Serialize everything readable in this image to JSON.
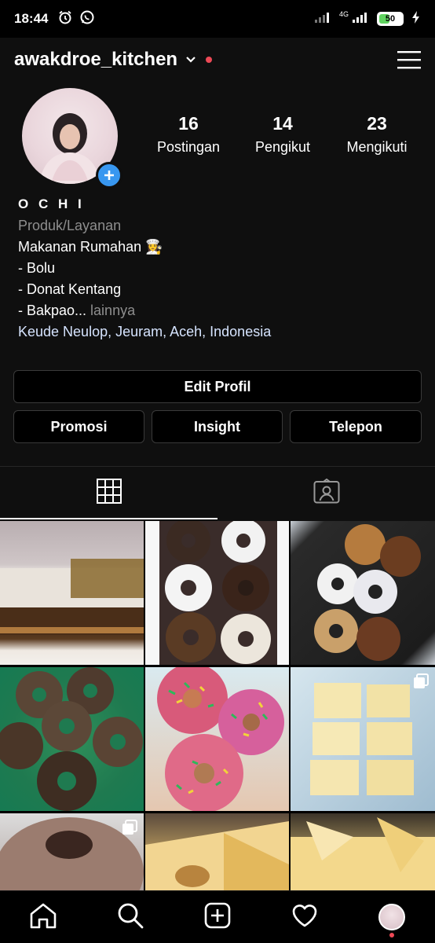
{
  "status_bar": {
    "time": "18:44",
    "network_label": "4G",
    "battery": "50",
    "battery_level": 0.5
  },
  "header": {
    "username": "awakdroe_kitchen",
    "notification_dot_color": "#ed4956"
  },
  "profile": {
    "stats": [
      {
        "value": "16",
        "label": "Postingan"
      },
      {
        "value": "14",
        "label": "Pengikut"
      },
      {
        "value": "23",
        "label": "Mengikuti"
      }
    ]
  },
  "bio": {
    "name": "O C H I",
    "category": "Produk/Layanan",
    "lines": [
      "Makanan Rumahan 👩‍🍳",
      "- Bolu",
      "- Donat Kentang"
    ],
    "truncated_line": "- Bakpao...",
    "more_label": " lainnya",
    "location": "Keude Neulop, Jeuram, Aceh, Indonesia"
  },
  "buttons": {
    "edit_profile": "Edit Profil",
    "promotion": "Promosi",
    "insight": "Insight",
    "phone": "Telepon"
  },
  "tabs": [
    {
      "icon": "grid-icon",
      "active": true
    },
    {
      "icon": "tagged-person-icon",
      "active": false
    }
  ],
  "posts": [
    {
      "art": "cake",
      "multi": false
    },
    {
      "art": "donuts-white",
      "multi": false
    },
    {
      "art": "donuts-tray",
      "multi": false
    },
    {
      "art": "green",
      "multi": false
    },
    {
      "art": "sprinkle",
      "multi": false
    },
    {
      "art": "cheese",
      "multi": true
    },
    {
      "art": "bundt",
      "multi": true
    },
    {
      "art": "bolu",
      "multi": false
    },
    {
      "art": "cake2",
      "multi": false
    }
  ],
  "bottom_nav": [
    {
      "icon": "home-icon"
    },
    {
      "icon": "search-icon"
    },
    {
      "icon": "new-post-icon"
    },
    {
      "icon": "heart-icon"
    },
    {
      "icon": "profile-avatar-icon"
    }
  ],
  "colors": {
    "background": "#0f0f0f",
    "accent_blue": "#3897f0",
    "muted_text": "#8e8e8e",
    "location_text": "#d6e4ff"
  }
}
